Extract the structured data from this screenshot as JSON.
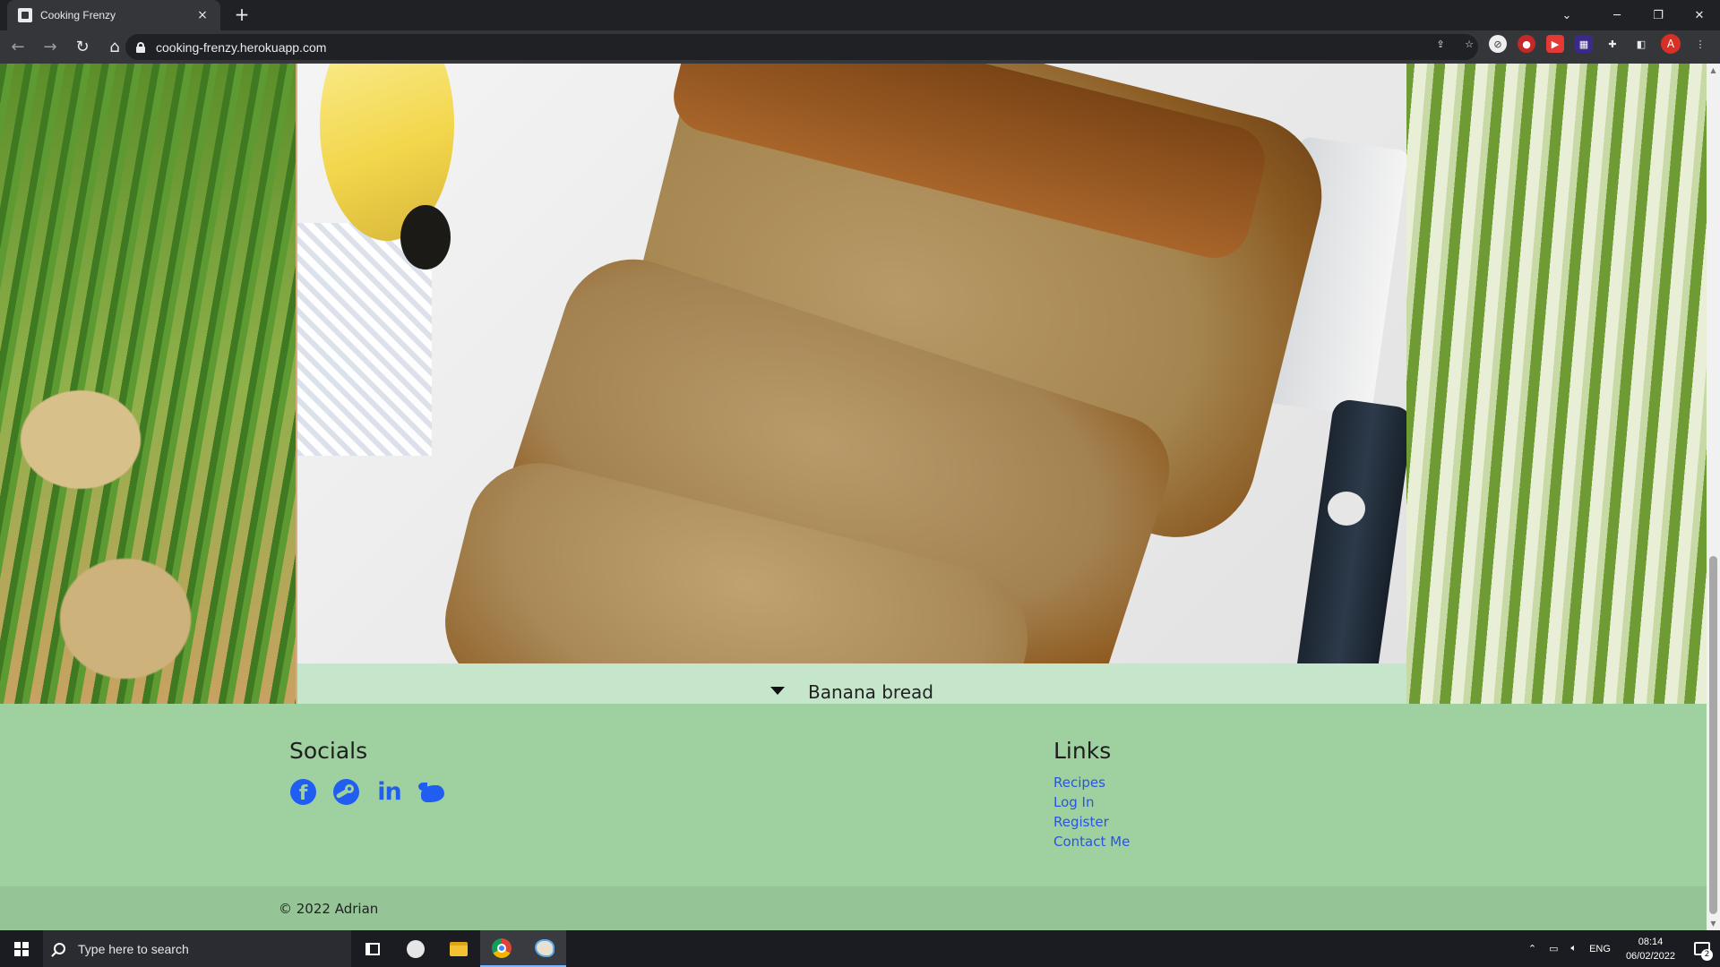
{
  "browser": {
    "tab_title": "Cooking Frenzy",
    "tab_close": "×",
    "new_tab": "+",
    "url": "cooking-frenzy.herokuapp.com",
    "profile_initial": "A",
    "window_controls": [
      "─",
      "❐",
      "✕"
    ],
    "tab_search": "⌄"
  },
  "page": {
    "card": {
      "image_alt": "banana-bread-photo",
      "caption": "Banana bread"
    },
    "footer": {
      "socials_heading": "Socials",
      "social_icons": [
        "facebook-icon",
        "steam-icon",
        "linkedin-icon",
        "twitter-icon"
      ],
      "linkedin_label": "in",
      "facebook_label": "f",
      "links_heading": "Links",
      "links": [
        "Recipes",
        "Log In",
        "Register",
        "Contact Me"
      ],
      "copyright": "© 2022 Adrian"
    }
  },
  "taskbar": {
    "search_placeholder": "Type here to search",
    "tray_lang": "ENG",
    "time": "08:14",
    "date": "06/02/2022",
    "notification_count": "2"
  },
  "colors": {
    "caption_bg": "#c6e6cb",
    "footer_bg": "#9fd0a0",
    "link": "#2a55e0",
    "social_icon": "#1f5ef0"
  }
}
